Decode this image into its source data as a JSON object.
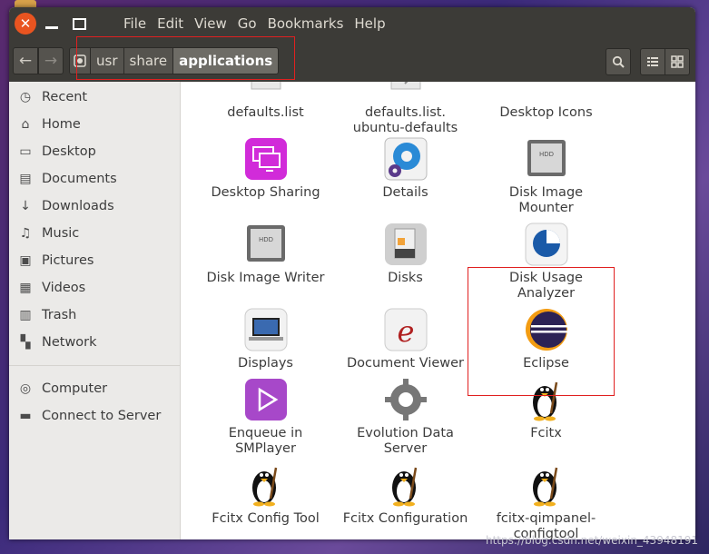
{
  "menubar": {
    "items": [
      "File",
      "Edit",
      "View",
      "Go",
      "Bookmarks",
      "Help"
    ]
  },
  "toolbar": {
    "breadcrumbs": [
      "usr",
      "share",
      "applications"
    ]
  },
  "sidebar": {
    "places": [
      "Recent",
      "Home",
      "Desktop",
      "Documents",
      "Downloads",
      "Music",
      "Pictures",
      "Videos",
      "Trash",
      "Network"
    ],
    "devices": [
      "Computer",
      "Connect to Server"
    ]
  },
  "files": [
    {
      "label": "defaults.list",
      "icon": "text-file-icon"
    },
    {
      "label": "defaults.list.\nubuntu-defaults",
      "icon": "text-file-icon"
    },
    {
      "label": "Desktop Icons",
      "icon": "gear-icon"
    },
    {
      "label": "Desktop Sharing",
      "icon": "desktop-sharing-icon"
    },
    {
      "label": "Details",
      "icon": "details-gear-icon"
    },
    {
      "label": "Disk Image\nMounter",
      "icon": "hdd-icon"
    },
    {
      "label": "Disk Image Writer",
      "icon": "hdd-icon"
    },
    {
      "label": "Disks",
      "icon": "disks-icon"
    },
    {
      "label": "Disk Usage\nAnalyzer",
      "icon": "pie-chart-icon"
    },
    {
      "label": "Displays",
      "icon": "laptop-icon"
    },
    {
      "label": "Document Viewer",
      "icon": "document-viewer-icon"
    },
    {
      "label": "Eclipse",
      "icon": "eclipse-icon"
    },
    {
      "label": "Enqueue in\nSMPlayer",
      "icon": "play-icon"
    },
    {
      "label": "Evolution Data\nServer",
      "icon": "gear-icon"
    },
    {
      "label": "Fcitx",
      "icon": "penguin-icon"
    },
    {
      "label": "Fcitx Config Tool",
      "icon": "penguin-icon"
    },
    {
      "label": "Fcitx Configuration",
      "icon": "penguin-icon"
    },
    {
      "label": "fcitx-qimpanel-\nconfigtool",
      "icon": "penguin-icon"
    }
  ],
  "colors": {
    "accent": "#e95420",
    "highlight": "#e02020",
    "menubar": "#3c3b37"
  },
  "watermark": "https://blog.csdn.net/weixin_43948191"
}
